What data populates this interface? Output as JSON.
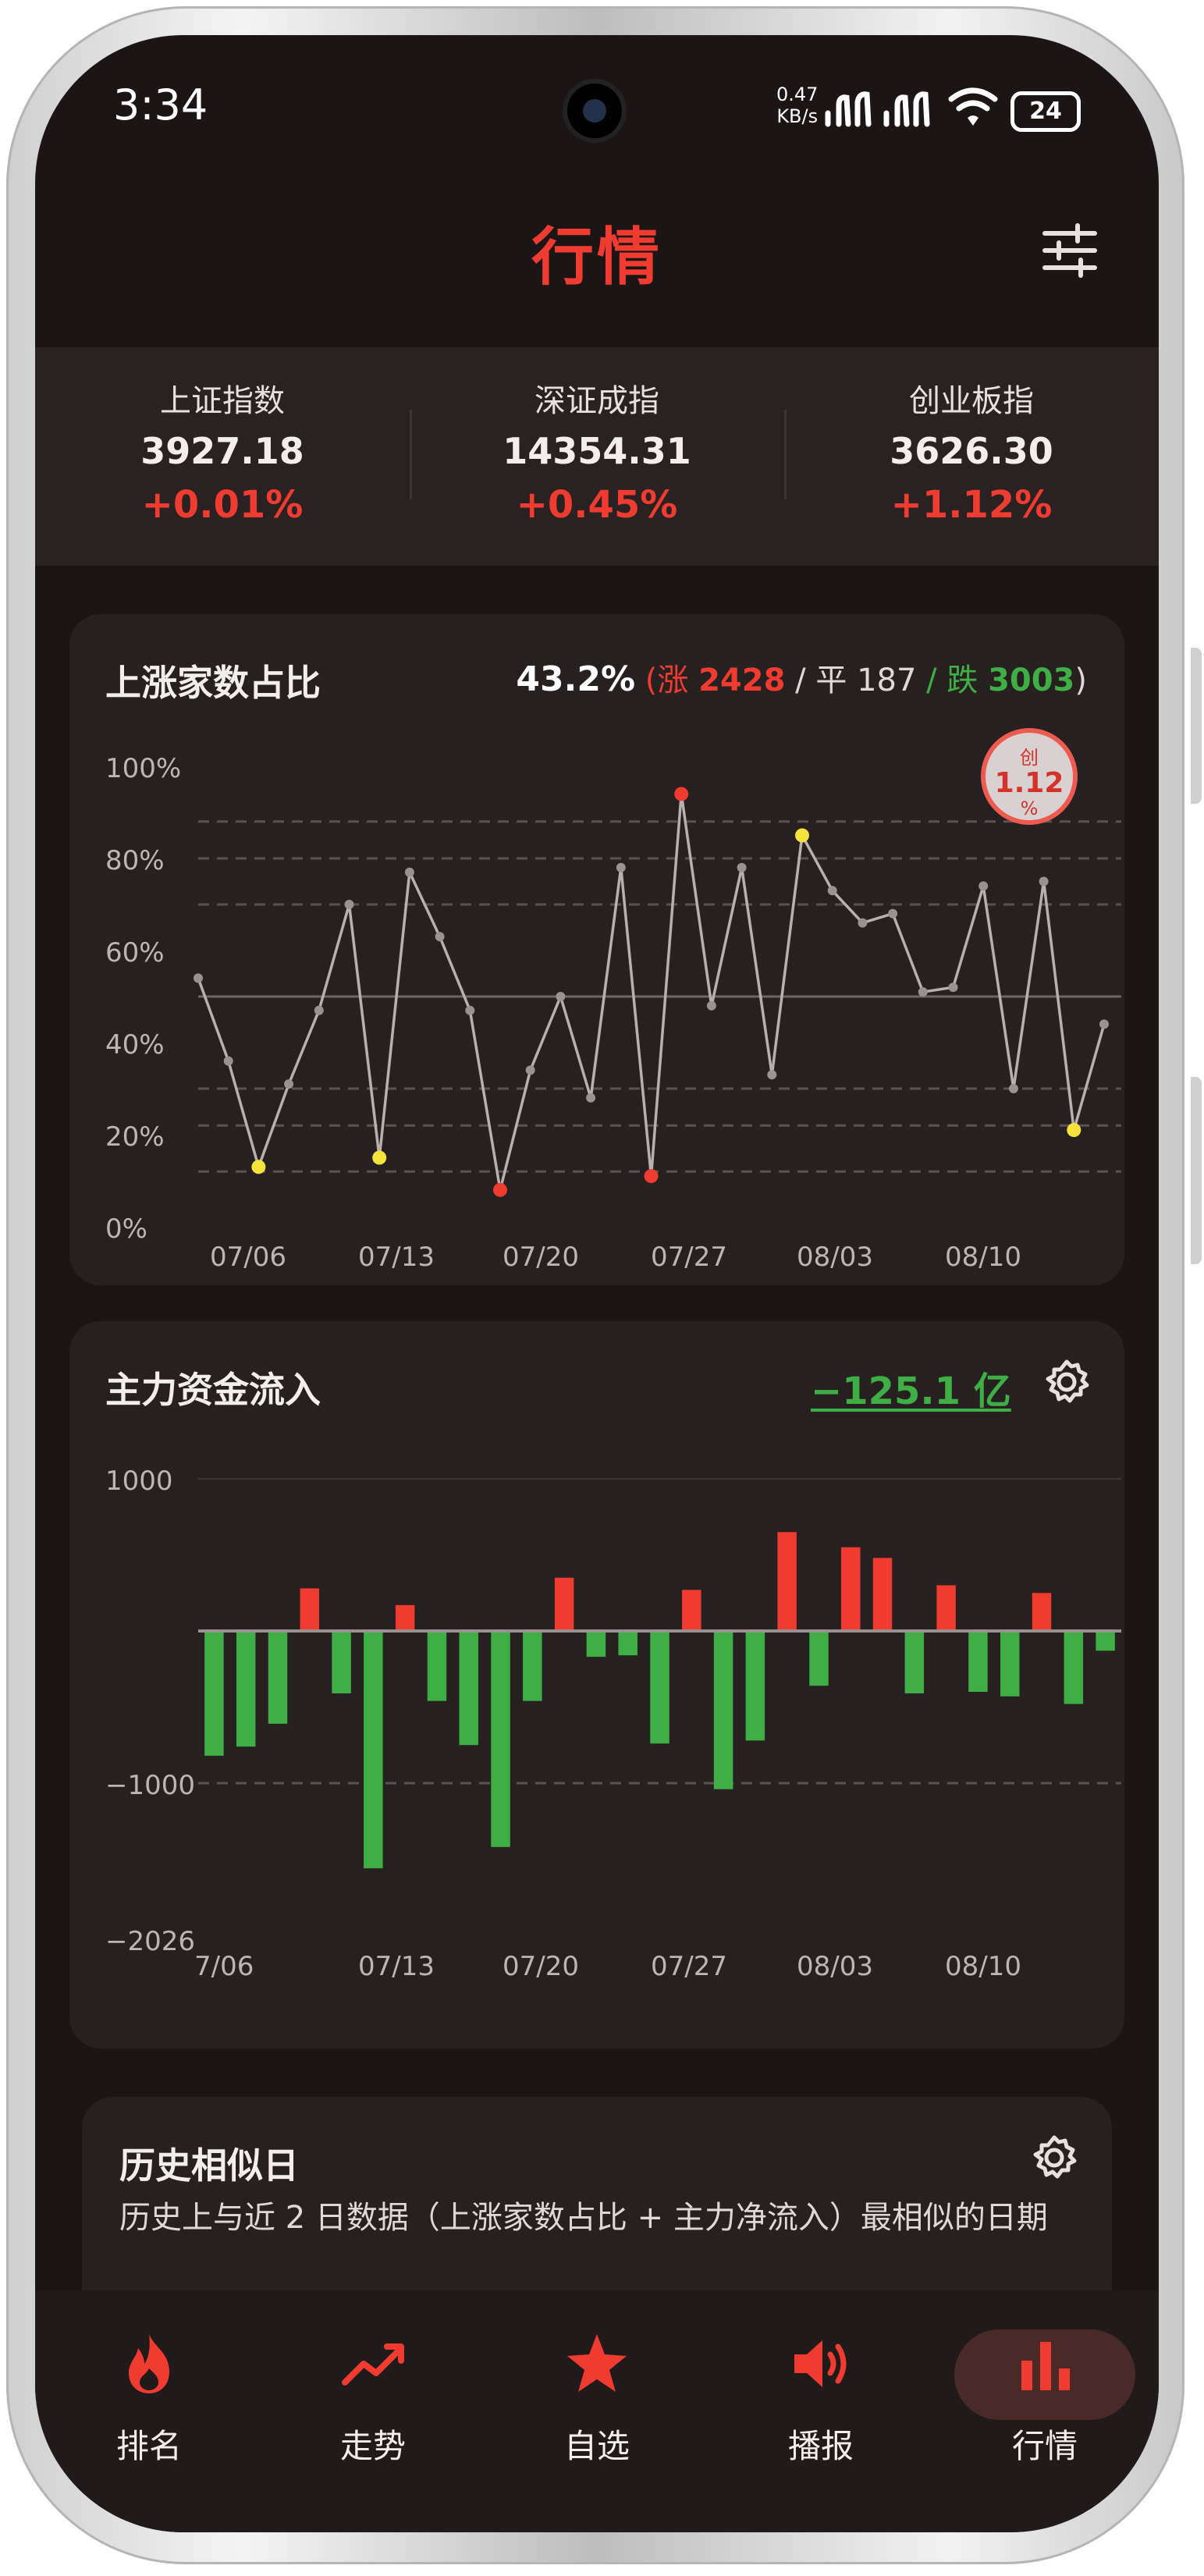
{
  "status_bar": {
    "time": "3:34",
    "net_speed_value": "0.47",
    "net_speed_unit": "KB/s",
    "battery": "24"
  },
  "header": {
    "title": "行情"
  },
  "indexes": [
    {
      "name": "上证指数",
      "value": "3927.18",
      "change": "+0.01%"
    },
    {
      "name": "深证成指",
      "value": "14354.31",
      "change": "+0.45%"
    },
    {
      "name": "创业板指",
      "value": "3626.30",
      "change": "+1.12%"
    }
  ],
  "ratio_card": {
    "title": "上涨家数占比",
    "summary_pct": "43.2%",
    "paren_open": "(",
    "up_label": "涨",
    "up_count": "2428",
    "sep1": "/",
    "flat_label": "平",
    "flat_count": "187",
    "sep2": "/",
    "down_label": "跌",
    "down_count": "3003",
    "paren_close": ")",
    "badge_top": "创",
    "badge_value": "1.12",
    "badge_bottom": "%"
  },
  "flow_card": {
    "title": "主力资金流入",
    "value": "−125.1 亿"
  },
  "similar_card": {
    "title": "历史相似日",
    "description": "历史上与近 2 日数据（上涨家数占比 + 主力净流入）最相似的日期"
  },
  "nav": {
    "items": [
      {
        "label": "排名",
        "icon": "flame-icon"
      },
      {
        "label": "走势",
        "icon": "trend-icon"
      },
      {
        "label": "自选",
        "icon": "star-icon"
      },
      {
        "label": "播报",
        "icon": "speaker-icon"
      },
      {
        "label": "行情",
        "icon": "bar-chart-icon",
        "active": true
      }
    ]
  },
  "colors": {
    "up": "#ef3b30",
    "down": "#3fae45",
    "highlight": "#f5e33b",
    "line": "#b8b0b0"
  },
  "chart_data": [
    {
      "type": "line",
      "title": "上涨家数占比",
      "y_tick_labels": [
        "100%",
        "80%",
        "60%",
        "40%",
        "20%",
        "0%"
      ],
      "ylim": [
        0,
        100
      ],
      "x_tick_labels": [
        "07/06",
        "07/13",
        "07/20",
        "07/27",
        "08/03",
        "08/10"
      ],
      "reference_lines": [
        50
      ],
      "dashed_lines": [
        88,
        80,
        70,
        30,
        22,
        12
      ],
      "series": [
        {
          "values": [
            54,
            36,
            13,
            31,
            47,
            70,
            15,
            77,
            63,
            47,
            8,
            34,
            50,
            28,
            78,
            11,
            94,
            48,
            78,
            33,
            85,
            73,
            66,
            68,
            51,
            52,
            74,
            30,
            75,
            21,
            44
          ],
          "red_points": [
            10,
            15,
            16
          ],
          "yellow_points": [
            2,
            6,
            20,
            29
          ]
        }
      ]
    },
    {
      "type": "bar",
      "title": "主力资金流入",
      "y_tick_labels": [
        "1000",
        "−1000",
        "−2026"
      ],
      "ylim": [
        -2026,
        1000
      ],
      "x_tick_labels": [
        "7/06",
        "07/13",
        "07/20",
        "07/27",
        "08/03",
        "08/10"
      ],
      "values": [
        -820,
        -760,
        -610,
        280,
        -410,
        -1560,
        170,
        -460,
        -750,
        -1420,
        -460,
        350,
        -170,
        -160,
        -740,
        270,
        -1040,
        -720,
        650,
        -360,
        550,
        480,
        -410,
        300,
        -400,
        -430,
        250,
        -480,
        -130
      ]
    }
  ]
}
